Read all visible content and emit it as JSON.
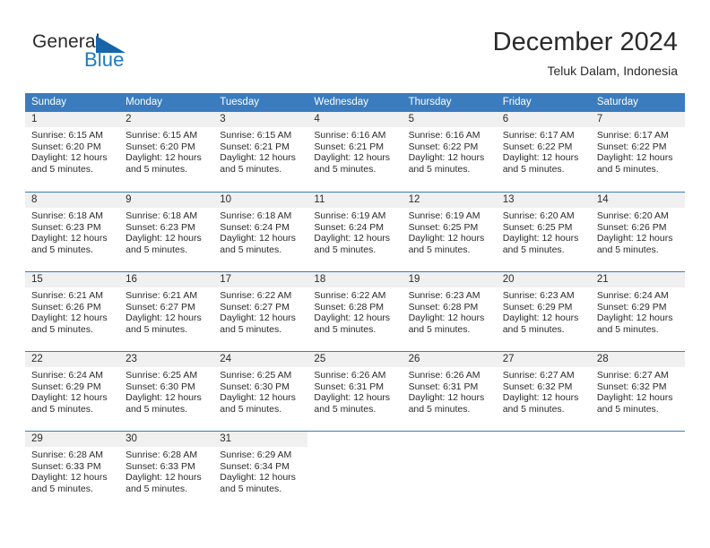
{
  "brand": {
    "name_part1": "General",
    "name_part2": "Blue",
    "logo_icon": "triangle-flag-icon",
    "accent_color": "#1b7bc4"
  },
  "header": {
    "month_title": "December 2024",
    "location": "Teluk Dalam, Indonesia"
  },
  "calendar": {
    "header_color": "#3a7cbe",
    "day_band_color": "#f0f0f0",
    "weekdays": [
      "Sunday",
      "Monday",
      "Tuesday",
      "Wednesday",
      "Thursday",
      "Friday",
      "Saturday"
    ],
    "weeks": [
      [
        {
          "day": "1",
          "sunrise": "Sunrise: 6:15 AM",
          "sunset": "Sunset: 6:20 PM",
          "daylight": "Daylight: 12 hours and 5 minutes."
        },
        {
          "day": "2",
          "sunrise": "Sunrise: 6:15 AM",
          "sunset": "Sunset: 6:20 PM",
          "daylight": "Daylight: 12 hours and 5 minutes."
        },
        {
          "day": "3",
          "sunrise": "Sunrise: 6:15 AM",
          "sunset": "Sunset: 6:21 PM",
          "daylight": "Daylight: 12 hours and 5 minutes."
        },
        {
          "day": "4",
          "sunrise": "Sunrise: 6:16 AM",
          "sunset": "Sunset: 6:21 PM",
          "daylight": "Daylight: 12 hours and 5 minutes."
        },
        {
          "day": "5",
          "sunrise": "Sunrise: 6:16 AM",
          "sunset": "Sunset: 6:22 PM",
          "daylight": "Daylight: 12 hours and 5 minutes."
        },
        {
          "day": "6",
          "sunrise": "Sunrise: 6:17 AM",
          "sunset": "Sunset: 6:22 PM",
          "daylight": "Daylight: 12 hours and 5 minutes."
        },
        {
          "day": "7",
          "sunrise": "Sunrise: 6:17 AM",
          "sunset": "Sunset: 6:22 PM",
          "daylight": "Daylight: 12 hours and 5 minutes."
        }
      ],
      [
        {
          "day": "8",
          "sunrise": "Sunrise: 6:18 AM",
          "sunset": "Sunset: 6:23 PM",
          "daylight": "Daylight: 12 hours and 5 minutes."
        },
        {
          "day": "9",
          "sunrise": "Sunrise: 6:18 AM",
          "sunset": "Sunset: 6:23 PM",
          "daylight": "Daylight: 12 hours and 5 minutes."
        },
        {
          "day": "10",
          "sunrise": "Sunrise: 6:18 AM",
          "sunset": "Sunset: 6:24 PM",
          "daylight": "Daylight: 12 hours and 5 minutes."
        },
        {
          "day": "11",
          "sunrise": "Sunrise: 6:19 AM",
          "sunset": "Sunset: 6:24 PM",
          "daylight": "Daylight: 12 hours and 5 minutes."
        },
        {
          "day": "12",
          "sunrise": "Sunrise: 6:19 AM",
          "sunset": "Sunset: 6:25 PM",
          "daylight": "Daylight: 12 hours and 5 minutes."
        },
        {
          "day": "13",
          "sunrise": "Sunrise: 6:20 AM",
          "sunset": "Sunset: 6:25 PM",
          "daylight": "Daylight: 12 hours and 5 minutes."
        },
        {
          "day": "14",
          "sunrise": "Sunrise: 6:20 AM",
          "sunset": "Sunset: 6:26 PM",
          "daylight": "Daylight: 12 hours and 5 minutes."
        }
      ],
      [
        {
          "day": "15",
          "sunrise": "Sunrise: 6:21 AM",
          "sunset": "Sunset: 6:26 PM",
          "daylight": "Daylight: 12 hours and 5 minutes."
        },
        {
          "day": "16",
          "sunrise": "Sunrise: 6:21 AM",
          "sunset": "Sunset: 6:27 PM",
          "daylight": "Daylight: 12 hours and 5 minutes."
        },
        {
          "day": "17",
          "sunrise": "Sunrise: 6:22 AM",
          "sunset": "Sunset: 6:27 PM",
          "daylight": "Daylight: 12 hours and 5 minutes."
        },
        {
          "day": "18",
          "sunrise": "Sunrise: 6:22 AM",
          "sunset": "Sunset: 6:28 PM",
          "daylight": "Daylight: 12 hours and 5 minutes."
        },
        {
          "day": "19",
          "sunrise": "Sunrise: 6:23 AM",
          "sunset": "Sunset: 6:28 PM",
          "daylight": "Daylight: 12 hours and 5 minutes."
        },
        {
          "day": "20",
          "sunrise": "Sunrise: 6:23 AM",
          "sunset": "Sunset: 6:29 PM",
          "daylight": "Daylight: 12 hours and 5 minutes."
        },
        {
          "day": "21",
          "sunrise": "Sunrise: 6:24 AM",
          "sunset": "Sunset: 6:29 PM",
          "daylight": "Daylight: 12 hours and 5 minutes."
        }
      ],
      [
        {
          "day": "22",
          "sunrise": "Sunrise: 6:24 AM",
          "sunset": "Sunset: 6:29 PM",
          "daylight": "Daylight: 12 hours and 5 minutes."
        },
        {
          "day": "23",
          "sunrise": "Sunrise: 6:25 AM",
          "sunset": "Sunset: 6:30 PM",
          "daylight": "Daylight: 12 hours and 5 minutes."
        },
        {
          "day": "24",
          "sunrise": "Sunrise: 6:25 AM",
          "sunset": "Sunset: 6:30 PM",
          "daylight": "Daylight: 12 hours and 5 minutes."
        },
        {
          "day": "25",
          "sunrise": "Sunrise: 6:26 AM",
          "sunset": "Sunset: 6:31 PM",
          "daylight": "Daylight: 12 hours and 5 minutes."
        },
        {
          "day": "26",
          "sunrise": "Sunrise: 6:26 AM",
          "sunset": "Sunset: 6:31 PM",
          "daylight": "Daylight: 12 hours and 5 minutes."
        },
        {
          "day": "27",
          "sunrise": "Sunrise: 6:27 AM",
          "sunset": "Sunset: 6:32 PM",
          "daylight": "Daylight: 12 hours and 5 minutes."
        },
        {
          "day": "28",
          "sunrise": "Sunrise: 6:27 AM",
          "sunset": "Sunset: 6:32 PM",
          "daylight": "Daylight: 12 hours and 5 minutes."
        }
      ],
      [
        {
          "day": "29",
          "sunrise": "Sunrise: 6:28 AM",
          "sunset": "Sunset: 6:33 PM",
          "daylight": "Daylight: 12 hours and 5 minutes."
        },
        {
          "day": "30",
          "sunrise": "Sunrise: 6:28 AM",
          "sunset": "Sunset: 6:33 PM",
          "daylight": "Daylight: 12 hours and 5 minutes."
        },
        {
          "day": "31",
          "sunrise": "Sunrise: 6:29 AM",
          "sunset": "Sunset: 6:34 PM",
          "daylight": "Daylight: 12 hours and 5 minutes."
        },
        {
          "day": "",
          "sunrise": "",
          "sunset": "",
          "daylight": ""
        },
        {
          "day": "",
          "sunrise": "",
          "sunset": "",
          "daylight": ""
        },
        {
          "day": "",
          "sunrise": "",
          "sunset": "",
          "daylight": ""
        },
        {
          "day": "",
          "sunrise": "",
          "sunset": "",
          "daylight": ""
        }
      ]
    ]
  }
}
